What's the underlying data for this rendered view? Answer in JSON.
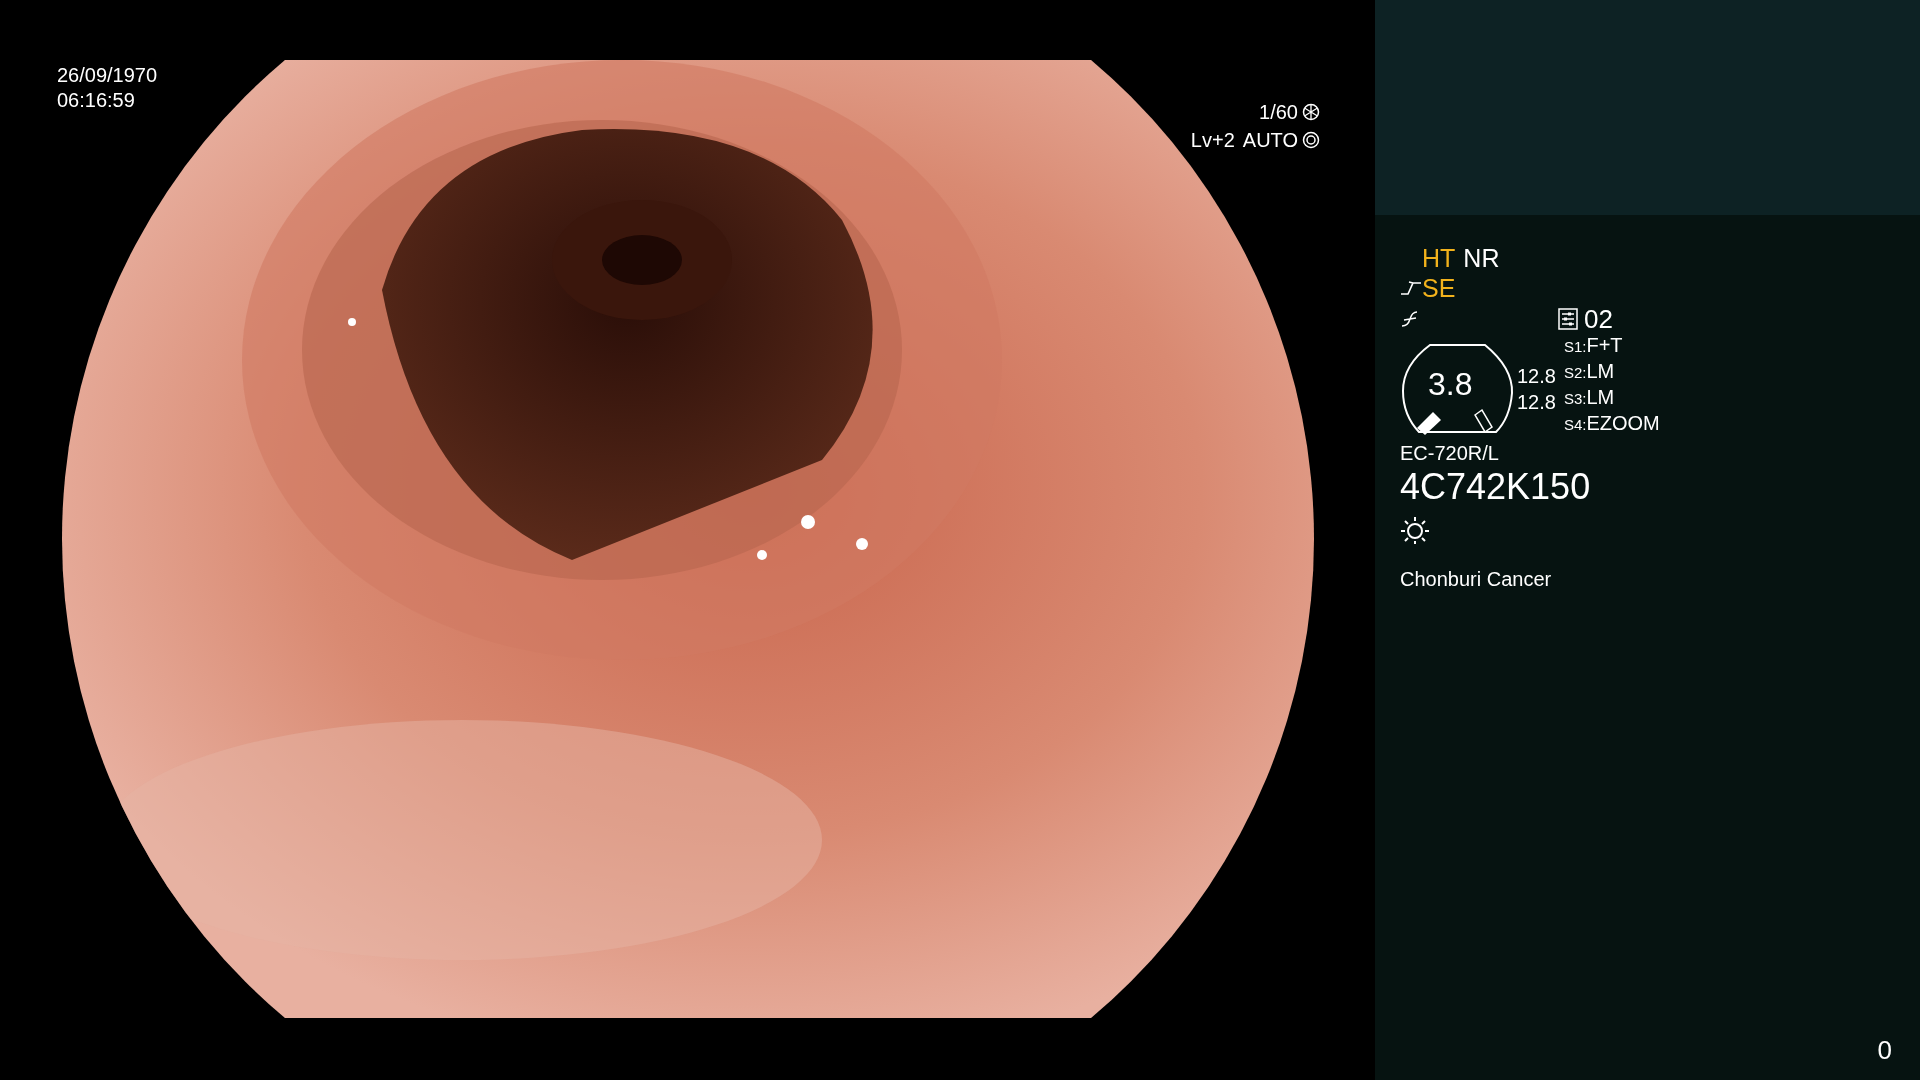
{
  "datetime": {
    "date": "26/09/1970",
    "time": "06:16:59"
  },
  "exposure": {
    "shutter": "1/60",
    "level": "Lv+2",
    "mode": "AUTO"
  },
  "enhancements": [
    {
      "label": "HT",
      "active": true
    },
    {
      "label": "NR",
      "active": false
    }
  ],
  "structure_enhancement": {
    "label": "SE",
    "active": true
  },
  "preset": "02",
  "zoom_gauge": {
    "value": "3.8",
    "readings": [
      "12.8",
      "12.8"
    ]
  },
  "switches": [
    {
      "key": "S1:",
      "value": "F+T"
    },
    {
      "key": "S2:",
      "value": "LM"
    },
    {
      "key": "S3:",
      "value": "LM"
    },
    {
      "key": "S4:",
      "value": "EZOOM"
    }
  ],
  "scope_model": "EC-720R/L",
  "serial": "4C742K150",
  "institution": "Chonburi Cancer",
  "counter": "0"
}
